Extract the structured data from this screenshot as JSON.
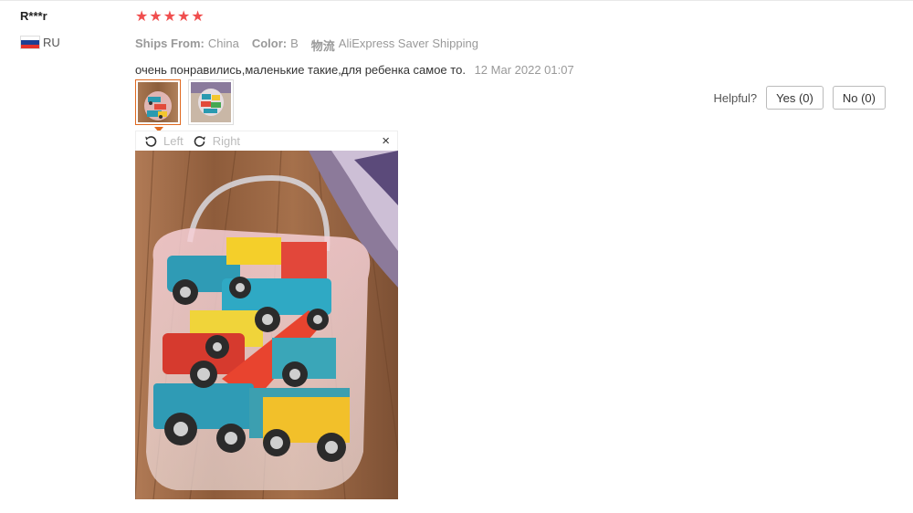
{
  "buyer": {
    "name": "R***r",
    "country_code": "RU",
    "flag_icon": "russia-flag-icon"
  },
  "review": {
    "rating": 5,
    "ships_from_label": "Ships From:",
    "ships_from_value": "China",
    "color_label": "Color:",
    "color_value": "B",
    "logistics_label": "物流",
    "logistics_value": "AliExpress Saver Shipping",
    "text": "очень понравились,маленькие такие,для ребенка самое то.",
    "date": "12 Mar 2022 01:07"
  },
  "helpful": {
    "label": "Helpful?",
    "yes_label": "Yes (0)",
    "no_label": "No (0)"
  },
  "viewer": {
    "rotate_left_label": "Left",
    "rotate_right_label": "Right",
    "close_symbol": "×"
  },
  "colors": {
    "star": "#f04e4e",
    "active_thumb_border": "#e0691f"
  }
}
